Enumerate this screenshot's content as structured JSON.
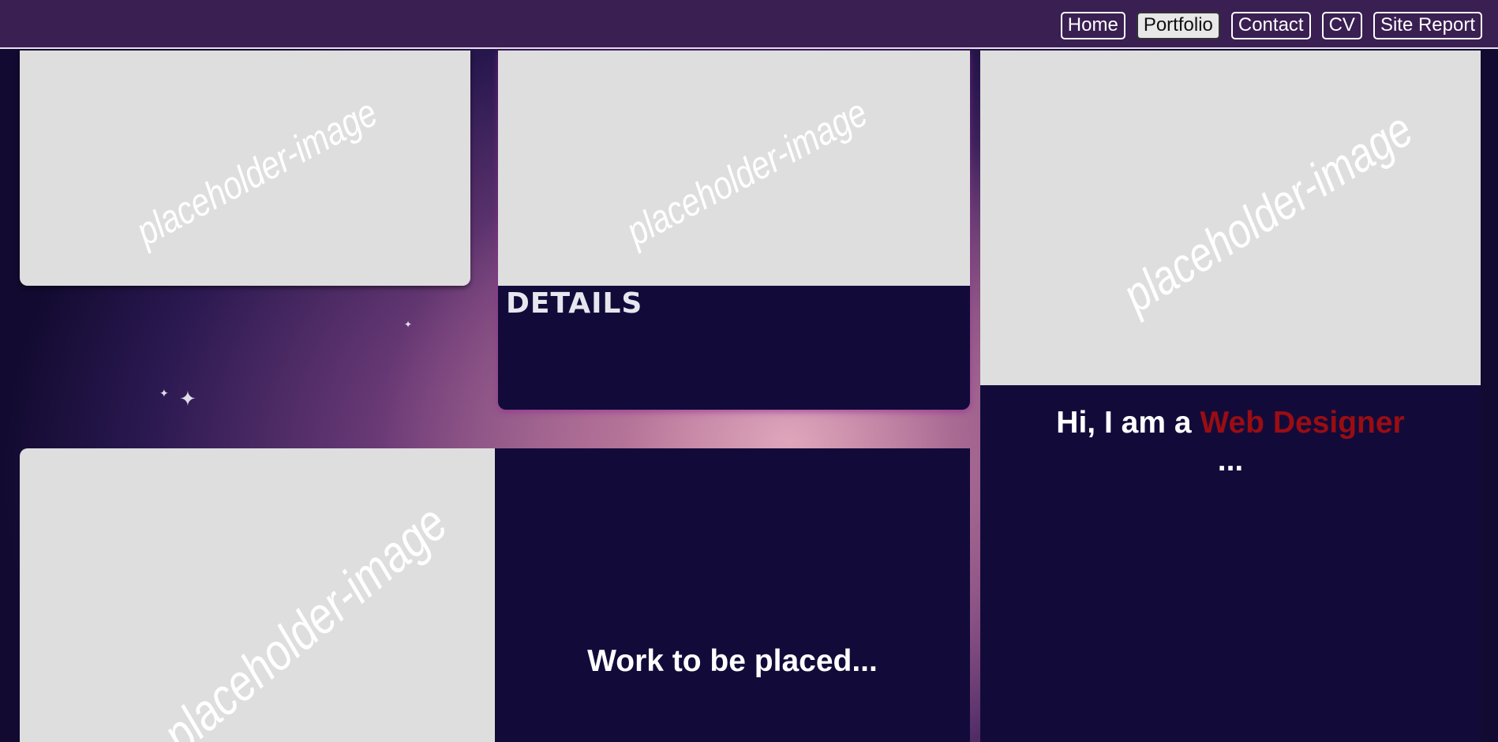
{
  "nav": {
    "items": [
      {
        "label": "Home",
        "active": false
      },
      {
        "label": "Portfolio",
        "active": true
      },
      {
        "label": "Contact",
        "active": false
      },
      {
        "label": "CV",
        "active": false
      },
      {
        "label": "Site Report",
        "active": false
      }
    ]
  },
  "placeholders": {
    "card1": "placeholder-image",
    "card2": "placeholder-image",
    "card3": "placeholder-image",
    "card4": "placeholder-image"
  },
  "details_card": {
    "label": "DETAILS"
  },
  "intro": {
    "prefix": "Hi, I am a ",
    "role": "Web Designer",
    "suffix": "..."
  },
  "work": {
    "text": "Work to be placed..."
  },
  "colors": {
    "nav_bg": "#3a1f52",
    "panel_dark": "#120b3a",
    "placeholder_gray": "#dedede",
    "accent_red": "#9a0d12"
  }
}
